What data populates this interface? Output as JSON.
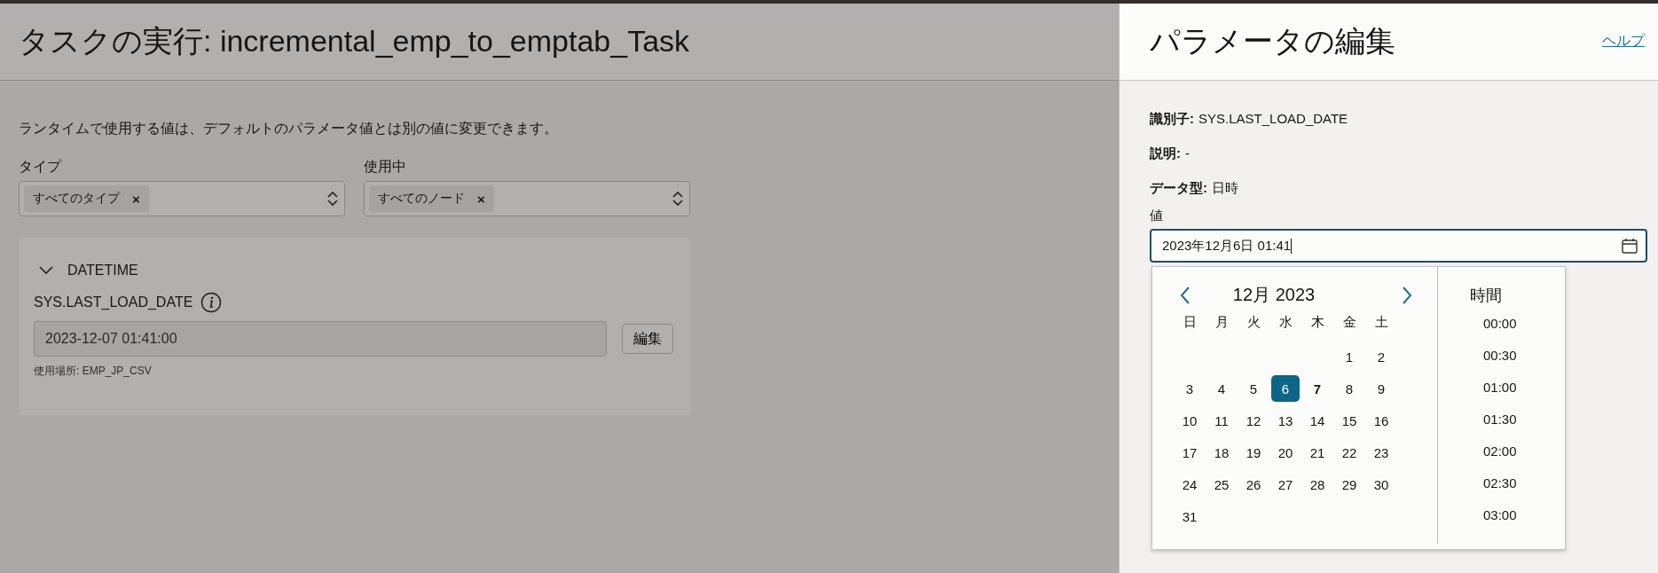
{
  "page": {
    "title": "タスクの実行: incremental_emp_to_emptab_Task",
    "description": "ランタイムで使用する値は、デフォルトのパラメータ値とは別の値に変更できます。",
    "filters": [
      {
        "label": "タイプ",
        "chip": "すべてのタイプ",
        "remove": "×"
      },
      {
        "label": "使用中",
        "chip": "すべてのノード",
        "remove": "×"
      }
    ],
    "section": {
      "title": "DATETIME",
      "expanded": true,
      "parameter": "SYS.LAST_LOAD_DATE",
      "value": "2023-12-07 01:41:00",
      "edit_button": "編集",
      "usage": "使用場所: EMP_JP_CSV"
    }
  },
  "panel": {
    "title": "パラメータの編集",
    "help_link": "ヘルプ",
    "properties": [
      "**識別子:** SYS.LAST_LOAD_DATE",
      "**説明:** -",
      "**データ型:** 日時"
    ],
    "value_label": "値",
    "value": "2023年12月6日 01:41",
    "calendar": {
      "month": "12月 2023",
      "weekdays": [
        "日",
        "月",
        "火",
        "水",
        "木",
        "金",
        "土"
      ],
      "weeks": [
        {
          "kind": "padded",
          "days": [
            {
              "day": "1",
              "selected": false,
              "today": false
            },
            {
              "day": "2",
              "selected": false,
              "today": false
            }
          ]
        },
        {
          "kind": "full",
          "days": [
            {
              "day": "3",
              "selected": false,
              "today": false
            },
            {
              "day": "4",
              "selected": false,
              "today": false
            },
            {
              "day": "5",
              "selected": false,
              "today": false
            },
            {
              "day": "6",
              "selected": true,
              "today": false
            },
            {
              "day": "7",
              "selected": false,
              "today": true
            },
            {
              "day": "8",
              "selected": false,
              "today": false
            },
            {
              "day": "9",
              "selected": false,
              "today": false
            }
          ]
        },
        {
          "kind": "full",
          "days": [
            {
              "day": "10",
              "selected": false,
              "today": false
            },
            {
              "day": "11",
              "selected": false,
              "today": false
            },
            {
              "day": "12",
              "selected": false,
              "today": false
            },
            {
              "day": "13",
              "selected": false,
              "today": false
            },
            {
              "day": "14",
              "selected": false,
              "today": false
            },
            {
              "day": "15",
              "selected": false,
              "today": false
            },
            {
              "day": "16",
              "selected": false,
              "today": false
            }
          ]
        },
        {
          "kind": "full",
          "days": [
            {
              "day": "17",
              "selected": false,
              "today": false
            },
            {
              "day": "18",
              "selected": false,
              "today": false
            },
            {
              "day": "19",
              "selected": false,
              "today": false
            },
            {
              "day": "20",
              "selected": false,
              "today": false
            },
            {
              "day": "21",
              "selected": false,
              "today": false
            },
            {
              "day": "22",
              "selected": false,
              "today": false
            },
            {
              "day": "23",
              "selected": false,
              "today": false
            }
          ]
        },
        {
          "kind": "full",
          "days": [
            {
              "day": "24",
              "selected": false,
              "today": false
            },
            {
              "day": "25",
              "selected": false,
              "today": false
            },
            {
              "day": "26",
              "selected": false,
              "today": false
            },
            {
              "day": "27",
              "selected": false,
              "today": false
            },
            {
              "day": "28",
              "selected": false,
              "today": false
            },
            {
              "day": "29",
              "selected": false,
              "today": false
            },
            {
              "day": "30",
              "selected": false,
              "today": false
            }
          ]
        },
        {
          "kind": "full",
          "days": [
            {
              "day": "31",
              "selected": false,
              "today": false
            }
          ]
        }
      ],
      "time_title": "時間",
      "times": [
        "00:00",
        "00:30",
        "01:00",
        "01:30",
        "02:00",
        "02:30",
        "03:00"
      ]
    }
  }
}
